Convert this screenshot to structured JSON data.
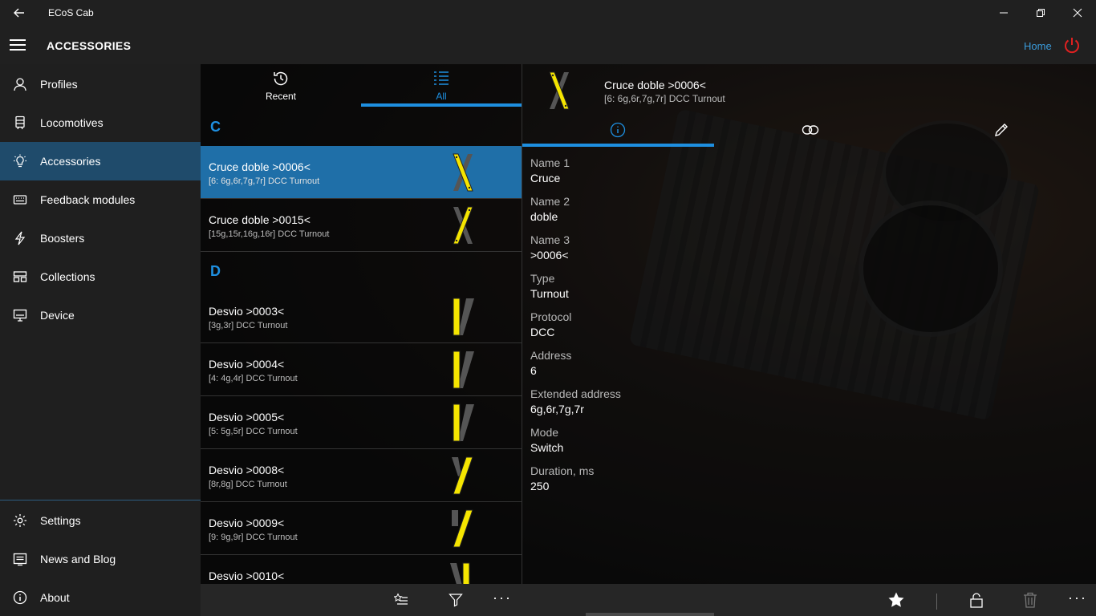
{
  "window": {
    "title": "ECoS Cab"
  },
  "header": {
    "title": "ACCESSORIES",
    "home_label": "Home"
  },
  "sidebar": {
    "items": [
      {
        "label": "Profiles",
        "icon": "person-icon"
      },
      {
        "label": "Locomotives",
        "icon": "locomotive-icon"
      },
      {
        "label": "Accessories",
        "icon": "lightbulb-icon",
        "active": true
      },
      {
        "label": "Feedback modules",
        "icon": "keyboard-icon"
      },
      {
        "label": "Boosters",
        "icon": "lightning-icon"
      },
      {
        "label": "Collections",
        "icon": "collection-icon"
      },
      {
        "label": "Device",
        "icon": "monitor-icon"
      }
    ],
    "bottom_items": [
      {
        "label": "Settings",
        "icon": "gear-icon"
      },
      {
        "label": "News and Blog",
        "icon": "news-icon"
      },
      {
        "label": "About",
        "icon": "info-icon"
      }
    ]
  },
  "pivot": {
    "recent_label": "Recent",
    "all_label": "All",
    "active": "All"
  },
  "list": {
    "groups": [
      {
        "letter": "C"
      },
      {
        "letter": "D"
      }
    ],
    "rows": [
      {
        "name": "Cruce doble >0006<",
        "desc": "[6: 6g,6r,7g,7r]  DCC  Turnout",
        "symbol": "crossing-icon",
        "selected": true
      },
      {
        "name": "Cruce doble >0015<",
        "desc": "[15g,15r,16g,16r]  DCC  Turnout",
        "symbol": "crossing-icon"
      },
      {
        "name": "Desvio  >0003<",
        "desc": "[3g,3r]  DCC  Turnout",
        "symbol": "turnout-icon"
      },
      {
        "name": "Desvio  >0004<",
        "desc": "[4: 4g,4r]  DCC  Turnout",
        "symbol": "turnout-icon"
      },
      {
        "name": "Desvio  >0005<",
        "desc": "[5: 5g,5r]  DCC  Turnout",
        "symbol": "turnout-icon"
      },
      {
        "name": "Desvio  >0008<",
        "desc": "[8r,8g]  DCC  Turnout",
        "symbol": "turnout-icon"
      },
      {
        "name": "Desvio  >0009<",
        "desc": "[9: 9g,9r]  DCC  Turnout",
        "symbol": "turnout-icon"
      },
      {
        "name": "Desvio  >0010<",
        "desc": "",
        "symbol": "turnout-icon"
      }
    ]
  },
  "detail": {
    "title": "Cruce doble >0006<",
    "subtitle": "[6: 6g,6r,7g,7r]  DCC  Turnout",
    "tabs": [
      "info-icon",
      "link-icon",
      "pencil-icon"
    ],
    "fields": [
      {
        "label": "Name 1",
        "value": "Cruce"
      },
      {
        "label": "Name 2",
        "value": "doble"
      },
      {
        "label": "Name 3",
        "value": ">0006<"
      },
      {
        "label": "Type",
        "value": "Turnout"
      },
      {
        "label": "Protocol",
        "value": "DCC"
      },
      {
        "label": "Address",
        "value": "6"
      },
      {
        "label": "Extended address",
        "value": "6g,6r,7g,7r"
      },
      {
        "label": "Mode",
        "value": "Switch"
      },
      {
        "label": "Duration, ms",
        "value": "250"
      }
    ]
  },
  "commandbar": {
    "left": [
      "favorites-list-icon",
      "filter-icon",
      "more-icon"
    ],
    "right": [
      "star-icon",
      "unlock-icon",
      "delete-icon",
      "more-icon"
    ]
  },
  "colors": {
    "accent": "#1e8fe0",
    "selected": "#1f6fa8",
    "symbol": "#f5e500",
    "power": "#e02020"
  }
}
